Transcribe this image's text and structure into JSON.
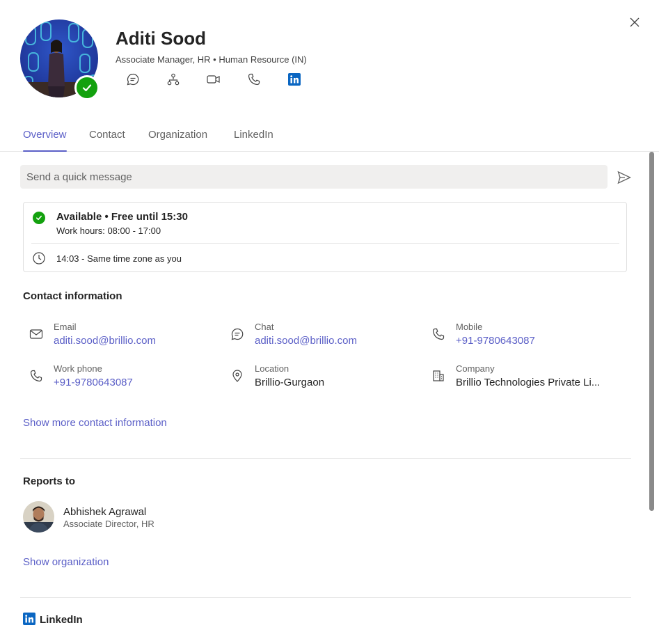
{
  "profile": {
    "name": "Aditi Sood",
    "subtitle": "Associate Manager, HR • Human Resource (IN)",
    "presence": "available",
    "actions": [
      "chat-icon",
      "org-chart-icon",
      "video-call-icon",
      "phone-icon",
      "linkedin-icon"
    ]
  },
  "tabs": [
    {
      "label": "Overview",
      "active": true
    },
    {
      "label": "Contact",
      "active": false
    },
    {
      "label": "Organization",
      "active": false
    },
    {
      "label": "LinkedIn",
      "active": false
    }
  ],
  "quick_message": {
    "placeholder": "Send a quick message"
  },
  "availability": {
    "status": "Available • Free until 15:30",
    "work_hours": "Work hours: 08:00 - 17:00",
    "timezone": "14:03 - Same time zone as you"
  },
  "contact": {
    "title": "Contact information",
    "items": [
      {
        "label": "Email",
        "value": "aditi.sood@brillio.com",
        "icon": "mail-icon"
      },
      {
        "label": "Chat",
        "value": "aditi.sood@brillio.com",
        "icon": "chat-icon"
      },
      {
        "label": "Mobile",
        "value": "+91-9780643087",
        "icon": "phone-icon"
      },
      {
        "label": "Work phone",
        "value": "+91-9780643087",
        "icon": "phone-icon"
      },
      {
        "label": "Location",
        "value": "Brillio-Gurgaon",
        "icon": "location-pin-icon"
      },
      {
        "label": "Company",
        "value": "Brillio Technologies Private Li...",
        "icon": "building-icon"
      }
    ],
    "show_more": "Show more contact information"
  },
  "reports_to": {
    "title": "Reports to",
    "manager_name": "Abhishek Agrawal",
    "manager_title": "Associate Director, HR",
    "show_org": "Show organization"
  },
  "linkedin": {
    "title": "LinkedIn"
  },
  "colors": {
    "accent": "#5b5fc7",
    "available": "#13a10e",
    "linkedin": "#0a66c2"
  }
}
